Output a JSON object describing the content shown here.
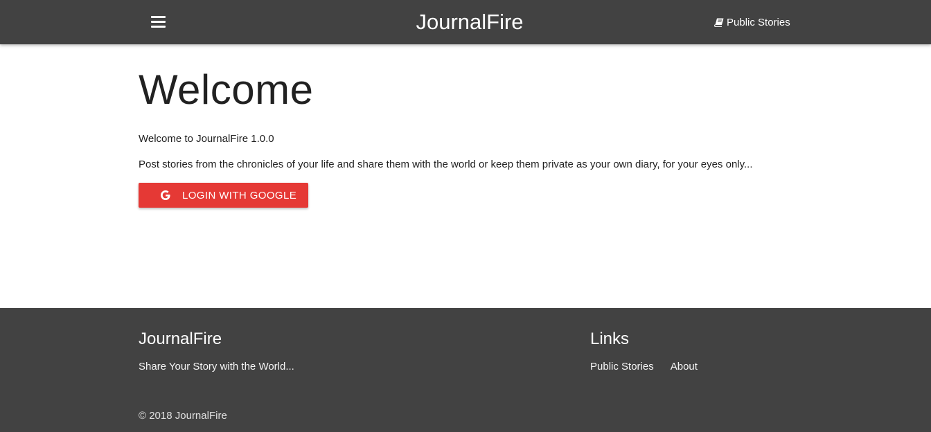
{
  "navbar": {
    "brand": "JournalFire",
    "public_stories_label": "Public Stories",
    "menu_icon": "hamburger-menu-icon",
    "stories_icon": "book-icon"
  },
  "main": {
    "title": "Welcome",
    "version_text": "Welcome to JournalFire 1.0.0",
    "description": "Post stories from the chronicles of your life and share them with the world or keep them private as your own diary, for your eyes only...",
    "login_button_label": "LOGIN WITH GOOGLE",
    "login_icon": "google-icon"
  },
  "footer": {
    "brand": "JournalFire",
    "slogan": "Share Your Story with the World...",
    "links_title": "Links",
    "links": [
      "Public Stories",
      "About"
    ],
    "copyright": "© 2018 JournalFire"
  },
  "colors": {
    "navbar_bg": "#424242",
    "footer_bg": "#424242",
    "login_button_bg": "#e53935",
    "text": "#212121"
  }
}
